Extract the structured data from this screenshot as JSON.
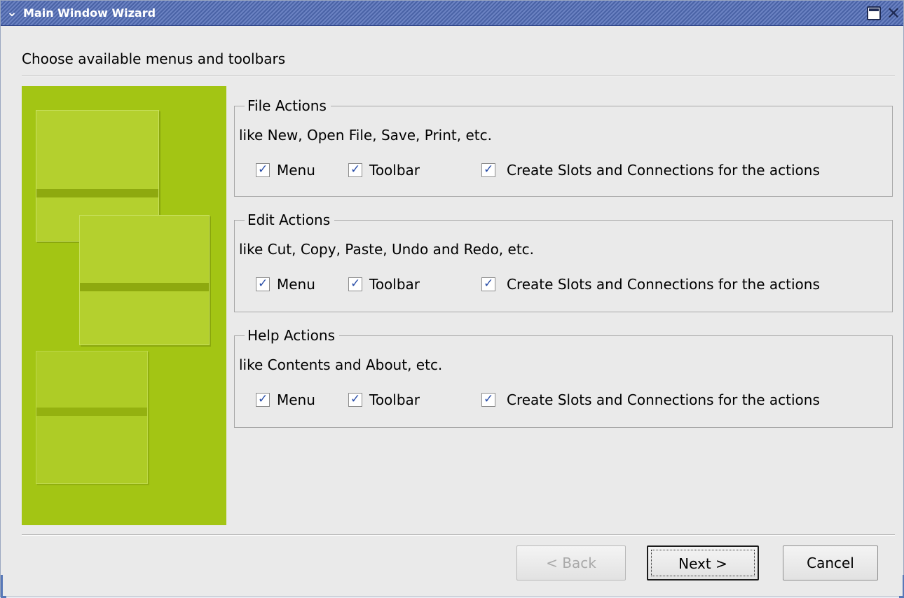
{
  "window": {
    "title": "Main Window Wizard",
    "menu_icon": "chevron-down-icon",
    "maximize_icon": "maximize-icon",
    "close_icon": "close-icon"
  },
  "heading": "Choose available menus and toolbars",
  "groups": [
    {
      "title": "File Actions",
      "description": "like New, Open File, Save, Print, etc.",
      "menu": {
        "label": "Menu",
        "checked": true
      },
      "toolbar": {
        "label": "Toolbar",
        "checked": true
      },
      "slots": {
        "label": "Create Slots and Connections for the actions",
        "checked": true
      }
    },
    {
      "title": "Edit Actions",
      "description": "like Cut, Copy, Paste, Undo and Redo, etc.",
      "menu": {
        "label": "Menu",
        "checked": true
      },
      "toolbar": {
        "label": "Toolbar",
        "checked": true
      },
      "slots": {
        "label": "Create Slots and Connections for the actions",
        "checked": true
      }
    },
    {
      "title": "Help Actions",
      "description": "like Contents and About, etc.",
      "menu": {
        "label": "Menu",
        "checked": true
      },
      "toolbar": {
        "label": "Toolbar",
        "checked": true
      },
      "slots": {
        "label": "Create Slots and Connections for the actions",
        "checked": true
      }
    }
  ],
  "side_image": {
    "color": "#a3c514"
  },
  "buttons": {
    "back": "< Back",
    "next": "Next >",
    "cancel": "Cancel"
  }
}
